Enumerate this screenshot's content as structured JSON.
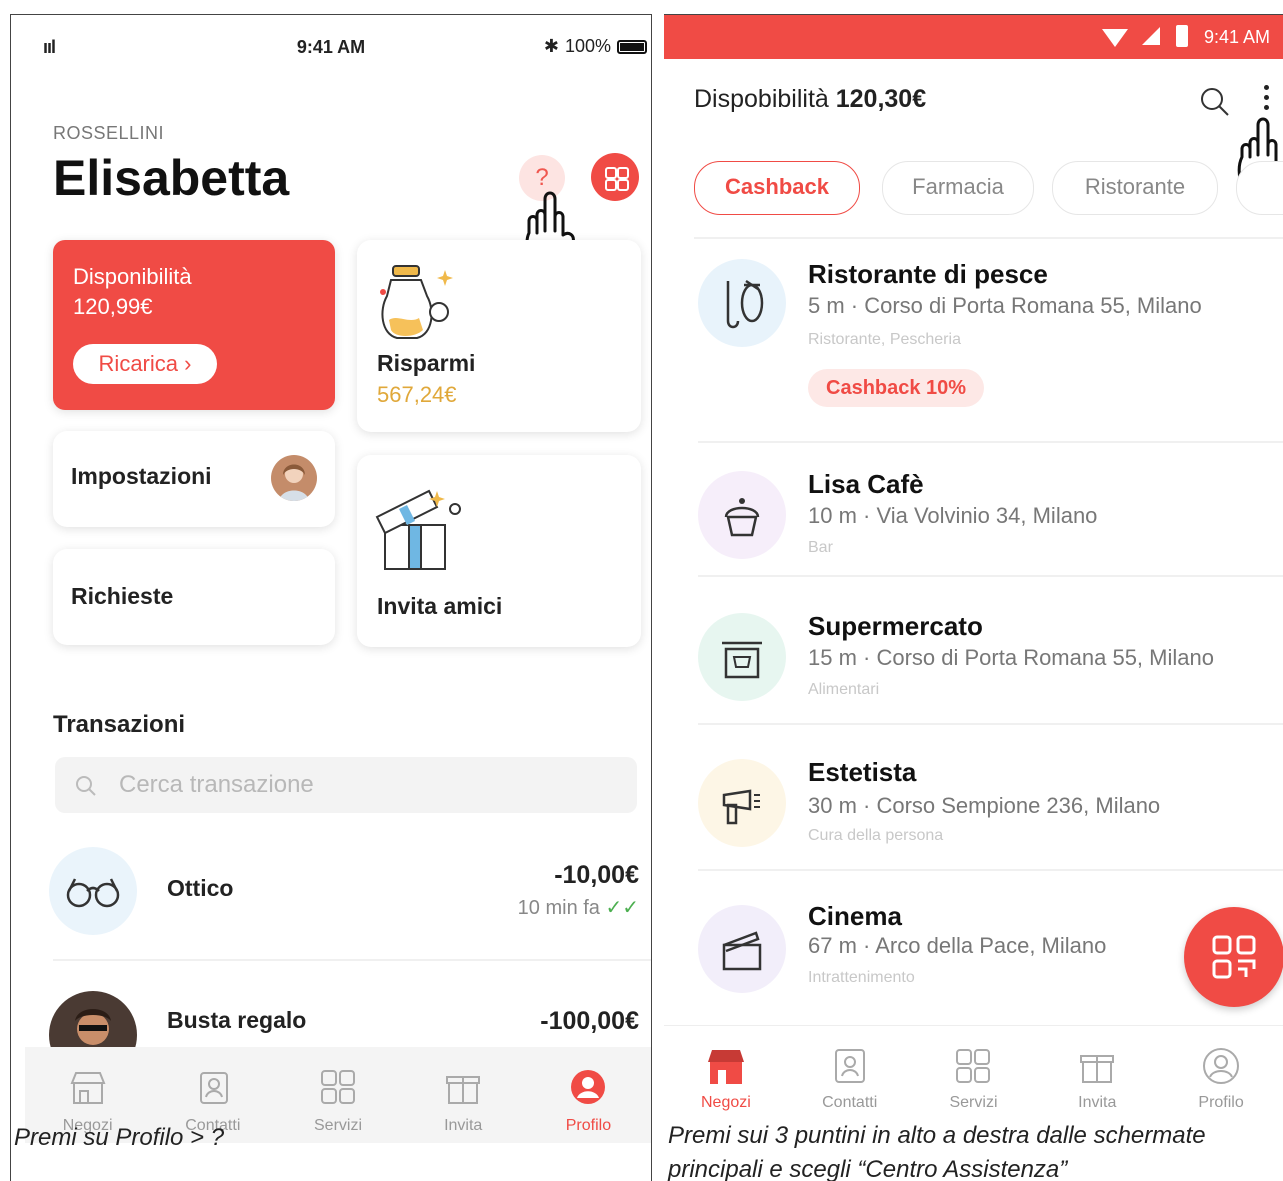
{
  "left": {
    "status": {
      "signal": "ııl",
      "time": "9:41 AM",
      "battery": "100%"
    },
    "surname": "ROSSELLINI",
    "firstname": "Elisabetta",
    "help_label": "?",
    "balance_card": {
      "title": "Disponibilità",
      "amount": "120,99€",
      "button": "Ricarica ›"
    },
    "savings_card": {
      "title": "Risparmi",
      "amount": "567,24€"
    },
    "settings_card": {
      "title": "Impostazioni"
    },
    "invite_card": {
      "title": "Invita amici"
    },
    "requests_card": {
      "title": "Richieste"
    },
    "transactions": {
      "title": "Transazioni",
      "search_placeholder": "Cerca transazione",
      "rows": [
        {
          "name": "Ottico",
          "amount": "-10,00€",
          "when": "10 min fa"
        },
        {
          "name": "Busta regalo",
          "amount": "-100,00€"
        }
      ]
    },
    "tabs": [
      "Negozi",
      "Contatti",
      "Servizi",
      "Invita",
      "Profilo"
    ],
    "active_tab": "Profilo",
    "caption": "Premi su Profilo > ?"
  },
  "right": {
    "status": {
      "time": "9:41 AM"
    },
    "availability_label": "Dispobibilità",
    "availability_amount": "120,30€",
    "chips": [
      "Cashback",
      "Farmacia",
      "Ristorante"
    ],
    "active_chip": "Cashback",
    "shops": [
      {
        "name": "Ristorante di pesce",
        "address": "5 m · Corso di Porta Romana 55, Milano",
        "category": "Ristorante, Pescheria",
        "badge": "Cashback 10%",
        "icon": "fish-icon",
        "color": "#e8f3fb"
      },
      {
        "name": "Lisa Cafè",
        "address": "10 m · Via Volvinio 34, Milano",
        "category": "Bar",
        "icon": "cupcake-icon",
        "color": "#f6eefa"
      },
      {
        "name": "Supermercato",
        "address": "15 m · Corso di Porta Romana 55, Milano",
        "category": "Alimentari",
        "icon": "shop-cart-icon",
        "color": "#e7f6f0"
      },
      {
        "name": "Estetista",
        "address": "30 m · Corso Sempione 236, Milano",
        "category": "Cura della persona",
        "icon": "hairdryer-icon",
        "color": "#fdf6e6"
      },
      {
        "name": "Cinema",
        "address": "67 m · Arco della Pace, Milano",
        "category": "Intrattenimento",
        "icon": "clapperboard-icon",
        "color": "#f2eefa"
      }
    ],
    "tabs": [
      "Negozi",
      "Contatti",
      "Servizi",
      "Invita",
      "Profilo"
    ],
    "active_tab": "Negozi",
    "caption": "Premi sui 3 puntini in alto a destra dalle schermate principali e scegli “Centro Assistenza”"
  },
  "colors": {
    "accent": "#f04b45",
    "gold": "#e0a83a"
  }
}
